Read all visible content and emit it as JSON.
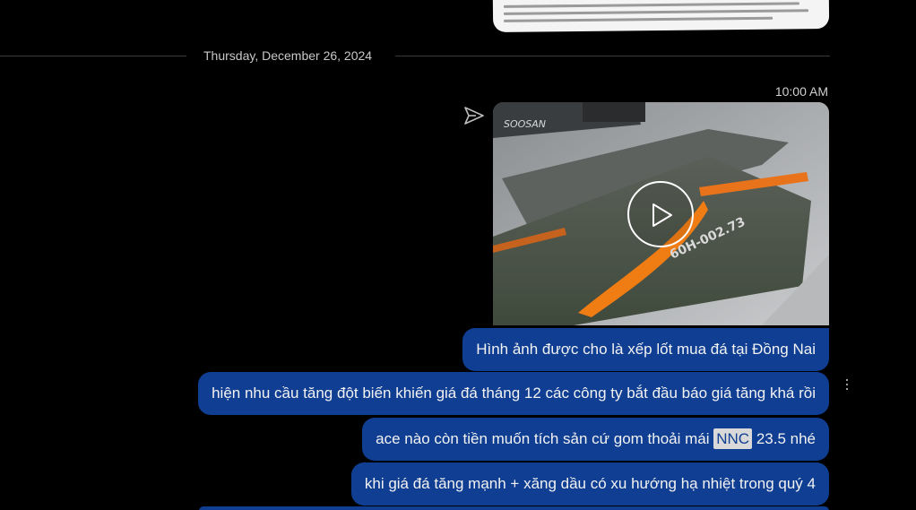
{
  "date_divider": "Thursday, December 26, 2024",
  "message_group": {
    "timestamp": "10:00 AM",
    "status_icon": "sent-icon",
    "video": {
      "play_icon": "play-icon",
      "truck_plate_text": "60H-002.73",
      "truck_brand_text": "SOOSAN"
    }
  },
  "messages": [
    {
      "text": "Hình ảnh được cho là xếp lốt mua đá tại Đồng Nai"
    },
    {
      "text": "hiện nhu cầu tăng đột biến khiến giá đá tháng 12 các công ty bắt đầu báo giá tăng khá rồi"
    },
    {
      "prefix": "ace nào còn tiền muốn tích sản cứ gom thoải mái ",
      "ticker": "NNC",
      "suffix": " 23.5 nhé"
    },
    {
      "text": "khi giá đá tăng mạnh + xăng dầu có xu hướng hạ nhiệt trong quý 4"
    }
  ],
  "colors": {
    "bubble": "#0f3e92",
    "background": "#000000",
    "ticker_highlight": "#d9d9d9"
  },
  "more_menu_icon": "more-vertical-icon"
}
